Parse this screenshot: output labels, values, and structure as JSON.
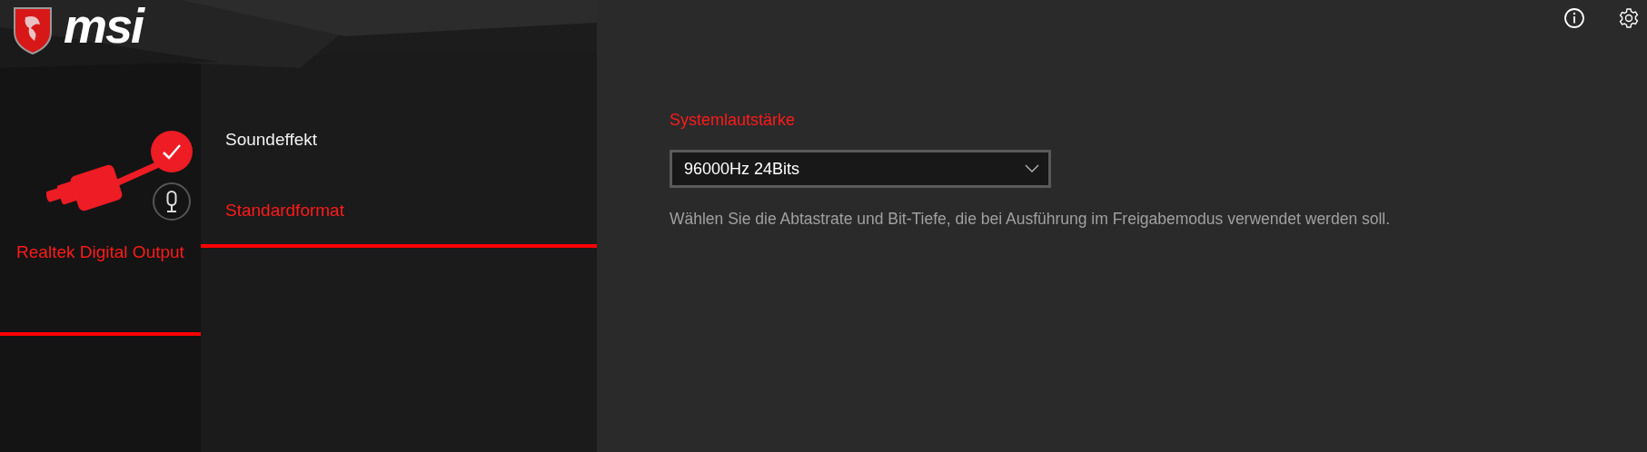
{
  "header": {
    "logo_text": "msi"
  },
  "devices": [
    {
      "name": "Realtek Digital Output",
      "selected": true,
      "default": true
    }
  ],
  "tabs": [
    {
      "label": "Soundeffekt",
      "selected": false
    },
    {
      "label": "Standardformat",
      "selected": true
    }
  ],
  "section": {
    "title": "Systemlautstärke",
    "select": {
      "value": "96000Hz 24Bits"
    },
    "description": "Wählen Sie die Abtastrate und Bit-Tiefe, die bei Ausführung im Freigabemodus verwendet werden soll."
  }
}
